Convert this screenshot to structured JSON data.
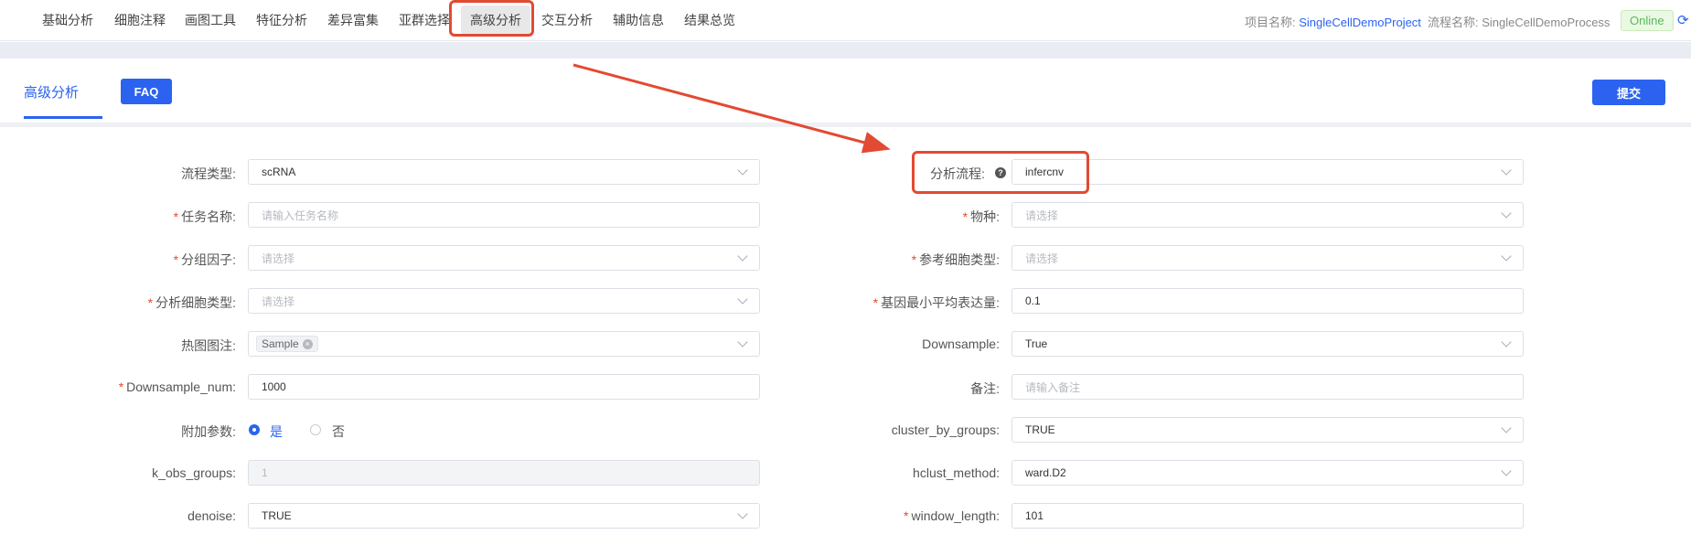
{
  "nav": {
    "items": [
      "基础分析",
      "细胞注释",
      "画图工具",
      "特征分析",
      "差异富集",
      "亚群选择",
      "高级分析",
      "交互分析",
      "辅助信息",
      "结果总览"
    ],
    "active": "高级分析"
  },
  "project": {
    "project_label": "项目名称:",
    "project_name": "SingleCellDemoProject",
    "process_label": "流程名称:",
    "process_name": "SingleCellDemoProcess",
    "status": "Online"
  },
  "tabs": {
    "current": "高级分析",
    "faq": "FAQ",
    "submit": "提交"
  },
  "form": {
    "left": [
      {
        "label": "流程类型:",
        "required": false,
        "value": "scRNA",
        "type": "select"
      },
      {
        "label": "任务名称:",
        "required": true,
        "placeholder": "请输入任务名称",
        "type": "input"
      },
      {
        "label": "分组因子:",
        "required": true,
        "placeholder": "请选择",
        "type": "select"
      },
      {
        "label": "分析细胞类型:",
        "required": true,
        "placeholder": "请选择",
        "type": "select"
      },
      {
        "label": "热图图注:",
        "required": false,
        "tag": "Sample",
        "type": "multiselect"
      },
      {
        "label": "Downsample_num:",
        "required": true,
        "value": "1000",
        "type": "input"
      },
      {
        "label": "附加参数:",
        "required": false,
        "type": "radio",
        "options": [
          "是",
          "否"
        ],
        "selected": "是"
      },
      {
        "label": "k_obs_groups:",
        "required": false,
        "value": "1",
        "type": "disabled"
      },
      {
        "label": "denoise:",
        "required": false,
        "value": "TRUE",
        "type": "select"
      }
    ],
    "right": [
      {
        "label": "分析流程:",
        "required": false,
        "value": "infercnv",
        "type": "select",
        "help": "?"
      },
      {
        "label": "物种:",
        "required": true,
        "placeholder": "请选择",
        "type": "select"
      },
      {
        "label": "参考细胞类型:",
        "required": true,
        "placeholder": "请选择",
        "type": "select"
      },
      {
        "label": "基因最小平均表达量:",
        "required": true,
        "value": "0.1",
        "type": "input"
      },
      {
        "label": "Downsample:",
        "required": false,
        "value": "True",
        "type": "select"
      },
      {
        "label": "备注:",
        "required": false,
        "placeholder": "请输入备注",
        "type": "input"
      },
      {
        "label": "cluster_by_groups:",
        "required": false,
        "value": "TRUE",
        "type": "select"
      },
      {
        "label": "hclust_method:",
        "required": false,
        "value": "ward.D2",
        "type": "select"
      },
      {
        "label": "window_length:",
        "required": true,
        "value": "101",
        "type": "input"
      }
    ]
  },
  "colors": {
    "accent": "#2b63f0",
    "highlight": "#e24a33",
    "required": "#e24a33"
  },
  "icons": {
    "refresh": "refresh-icon",
    "help": "question-circle-icon",
    "chevron": "chevron-down-icon",
    "tag_close": "close-circle-icon"
  }
}
